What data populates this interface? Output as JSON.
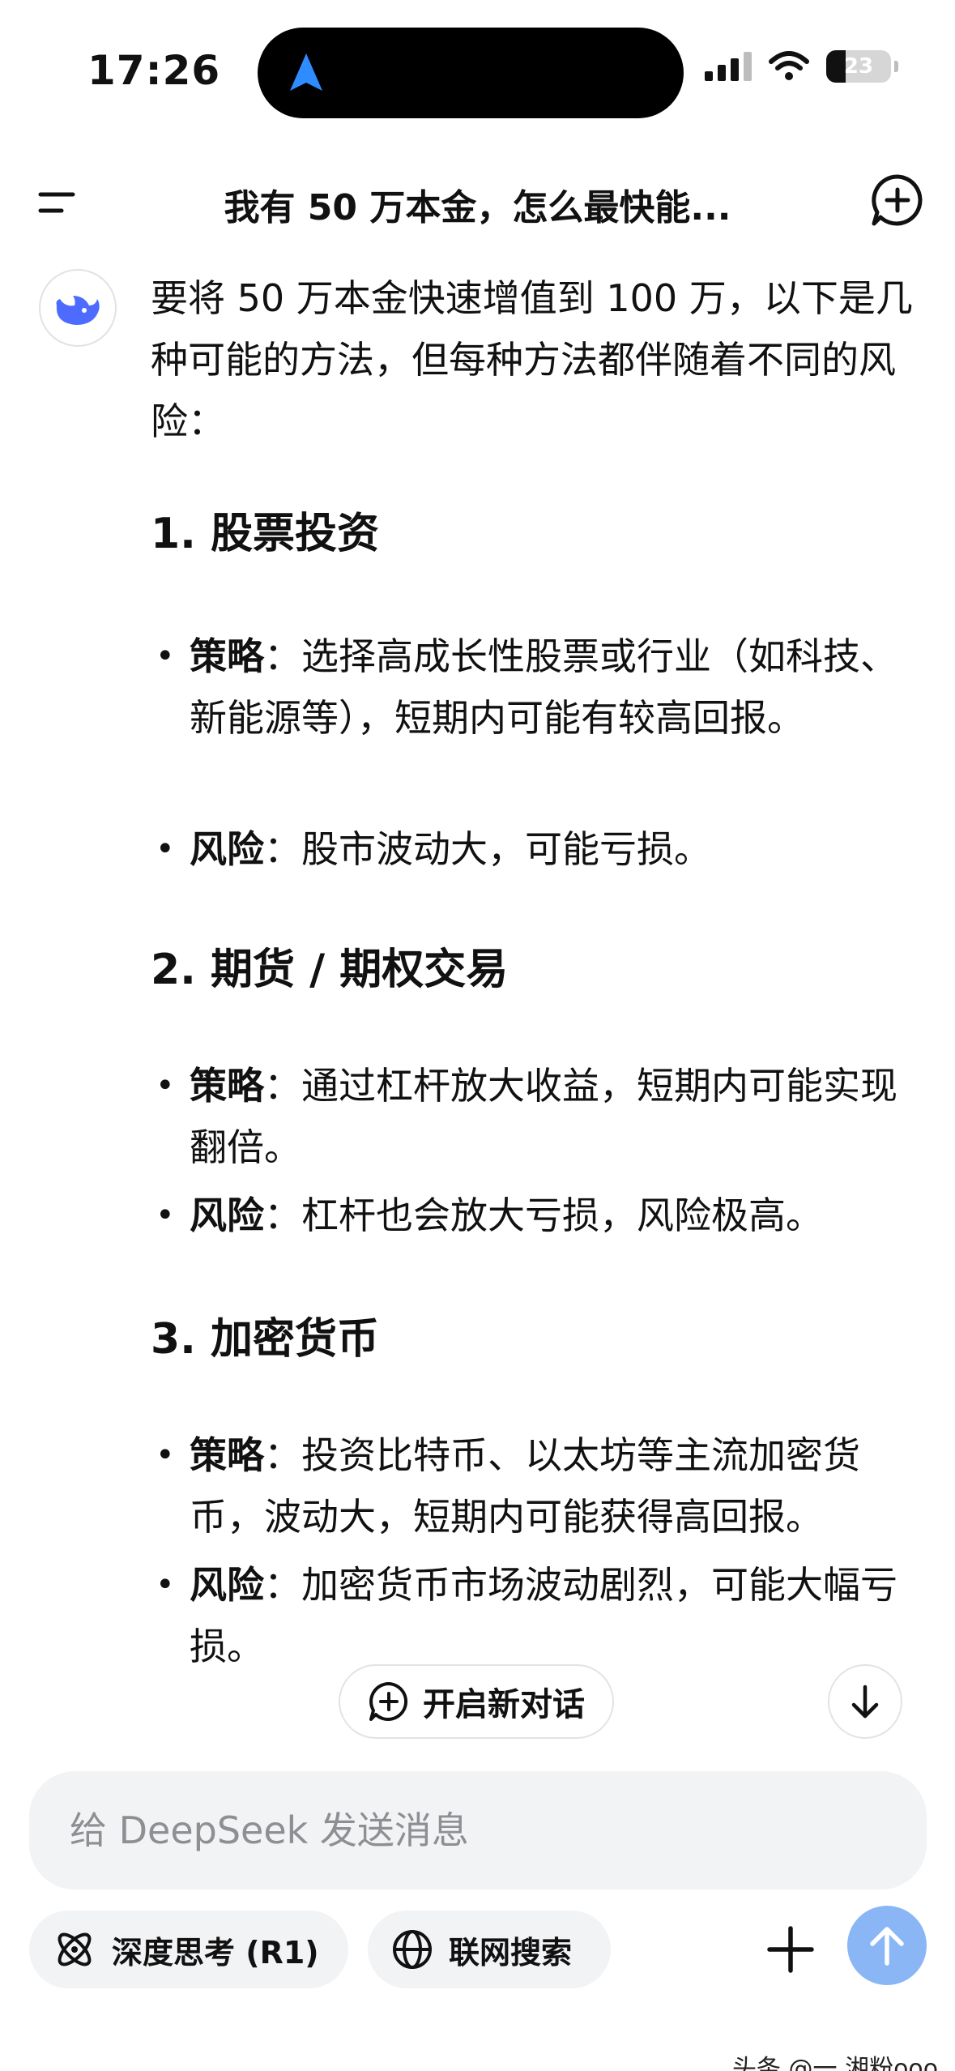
{
  "status_bar": {
    "time": "17:26",
    "battery": "23"
  },
  "header": {
    "title": "我有 50 万本金，怎么最快能..."
  },
  "message": {
    "intro": "要将 50 万本金快速增值到 100 万，以下是几种可能的方法，但每种方法都伴随着不同的风险：",
    "sections": [
      {
        "heading": "1. 股票投资",
        "strategy_label": "策略",
        "strategy_text": "：选择高成长性股票或行业（如科技、新能源等），短期内可能有较高回报。",
        "risk_label": "风险",
        "risk_text": "：股市波动大，可能亏损。"
      },
      {
        "heading": "2. 期货 / 期权交易",
        "strategy_label": "策略",
        "strategy_text": "：通过杠杆放大收益，短期内可能实现翻倍。",
        "risk_label": "风险",
        "risk_text": "：杠杆也会放大亏损，风险极高。"
      },
      {
        "heading": "3. 加密货币",
        "strategy_label": "策略",
        "strategy_text": "：投资比特币、以太坊等主流加密货币，波动大，短期内可能获得高回报。",
        "risk_label": "风险",
        "risk_text": "：加密货币市场波动剧烈，可能大幅亏损。"
      }
    ]
  },
  "floating": {
    "new_chat_label": "开启新对话"
  },
  "input": {
    "placeholder": "给 DeepSeek 发送消息"
  },
  "toolbar": {
    "deep_think_label": "深度思考 (R1)",
    "web_search_label": "联网搜索"
  },
  "watermark": "头条 @一 湘粉ooo",
  "colors": {
    "accent": "#4d6bfe",
    "send_button": "#8ab6f5",
    "input_bg": "#f2f3f5",
    "island_arrow": "#2f8cff"
  }
}
